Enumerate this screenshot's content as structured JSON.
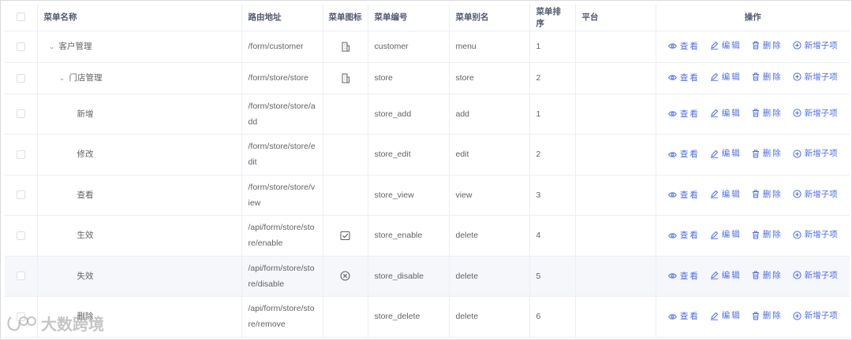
{
  "columns": {
    "name": "菜单名称",
    "route": "路由地址",
    "icon": "菜单图标",
    "code": "菜单编号",
    "alias": "菜单别名",
    "sort": "菜单排序",
    "platform": "平台",
    "actions": "操作"
  },
  "actions": {
    "view": "查看",
    "edit": "编辑",
    "delete": "删除",
    "add_child": "新增子项"
  },
  "rows": [
    {
      "name": "客户管理",
      "route": "/form/customer",
      "icon": "building-icon",
      "code": "customer",
      "alias": "menu",
      "sort": "1",
      "platform": ""
    },
    {
      "name": "门店管理",
      "route": "/form/store/store",
      "icon": "building-icon",
      "code": "store",
      "alias": "store",
      "sort": "2",
      "platform": ""
    },
    {
      "name": "新增",
      "route": "/form/store/store/add",
      "icon": "",
      "code": "store_add",
      "alias": "add",
      "sort": "1",
      "platform": ""
    },
    {
      "name": "修改",
      "route": "/form/store/store/edit",
      "icon": "",
      "code": "store_edit",
      "alias": "edit",
      "sort": "2",
      "platform": ""
    },
    {
      "name": "查看",
      "route": "/form/store/store/view",
      "icon": "",
      "code": "store_view",
      "alias": "view",
      "sort": "3",
      "platform": ""
    },
    {
      "name": "生效",
      "route": "/api/form/store/store/enable",
      "icon": "check-square-icon",
      "code": "store_enable",
      "alias": "delete",
      "sort": "4",
      "platform": ""
    },
    {
      "name": "失效",
      "route": "/api/form/store/store/disable",
      "icon": "x-circle-icon",
      "code": "store_disable",
      "alias": "delete",
      "sort": "5",
      "platform": ""
    },
    {
      "name": "删除",
      "route": "/api/form/store/store/remove",
      "icon": "",
      "code": "store_delete",
      "alias": "delete",
      "sort": "6",
      "platform": ""
    }
  ],
  "watermark": "大数跨境",
  "colors": {
    "link": "#4a6cf7",
    "header_text": "#515a6e",
    "row_hover": "#f5f7fa",
    "border": "#ebeef5"
  }
}
